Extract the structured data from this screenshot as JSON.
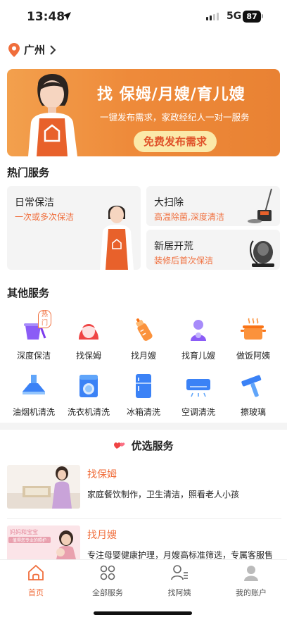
{
  "status": {
    "time": "13:48",
    "network": "5G",
    "battery": "87"
  },
  "location": {
    "city": "广州"
  },
  "banner": {
    "title": "找 保姆/月嫂/育儿嫂",
    "subtitle": "一键发布需求，家政经纪人一对一服务",
    "button_label": "免费发布需求"
  },
  "hot": {
    "title": "热门服务",
    "cards": [
      {
        "title": "日常保洁",
        "desc": "一次或多次保洁"
      },
      {
        "title": "大扫除",
        "desc": "高温除菌,深度清洁"
      },
      {
        "title": "新居开荒",
        "desc": "装修后首次保洁"
      }
    ]
  },
  "other": {
    "title": "其他服务",
    "hot_badge": "热门",
    "items": [
      {
        "label": "深度保洁",
        "icon": "cleaning-bucket-icon"
      },
      {
        "label": "找保姆",
        "icon": "nanny-icon"
      },
      {
        "label": "找月嫂",
        "icon": "baby-bottle-icon"
      },
      {
        "label": "找育儿嫂",
        "icon": "childcare-icon"
      },
      {
        "label": "做饭阿姨",
        "icon": "cooking-pot-icon"
      },
      {
        "label": "油烟机清洗",
        "icon": "range-hood-icon"
      },
      {
        "label": "洗衣机清洗",
        "icon": "washing-machine-icon"
      },
      {
        "label": "冰箱清洗",
        "icon": "fridge-icon"
      },
      {
        "label": "空调清洗",
        "icon": "air-conditioner-icon"
      },
      {
        "label": "擦玻璃",
        "icon": "window-wiper-icon"
      }
    ]
  },
  "preferred": {
    "title": "优选服务",
    "items": [
      {
        "name": "找保姆",
        "desc": "家庭餐饮制作，卫生清洁，照看老人小孩"
      },
      {
        "name": "找月嫂",
        "desc": "专注母婴健康护理，月嫂高标准筛选，专属客服售",
        "img_text_1": "妈妈和宝宝",
        "img_text_2": "· 值得您专业的照护 ·"
      }
    ]
  },
  "tabbar": {
    "tabs": [
      {
        "label": "首页",
        "icon": "home-icon"
      },
      {
        "label": "全部服务",
        "icon": "grid-icon"
      },
      {
        "label": "找阿姨",
        "icon": "user-list-icon"
      },
      {
        "label": "我的账户",
        "icon": "account-icon"
      }
    ]
  },
  "colors": {
    "accent": "#f06e3c",
    "banner": "#ee8a3a"
  }
}
